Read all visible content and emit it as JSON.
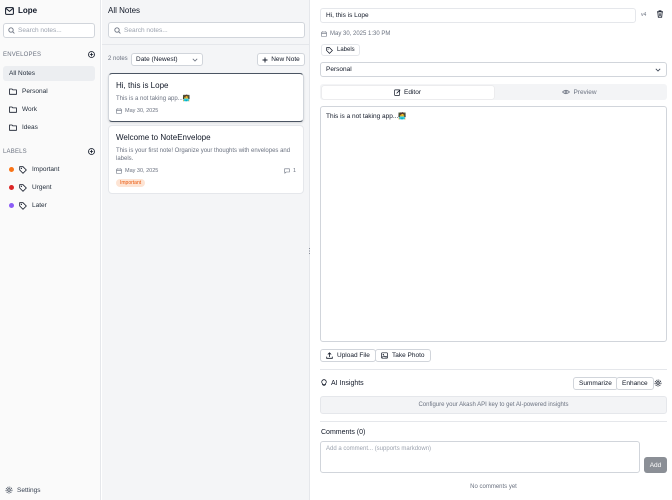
{
  "app": {
    "name": "Lope"
  },
  "sidebar": {
    "search_placeholder": "Search notes...",
    "envelopes_heading": "ENVELOPES",
    "envelopes": [
      {
        "label": "All Notes"
      },
      {
        "label": "Personal"
      },
      {
        "label": "Work"
      },
      {
        "label": "Ideas"
      }
    ],
    "labels_heading": "LABELS",
    "labels": [
      {
        "label": "Important",
        "color": "#f97316"
      },
      {
        "label": "Urgent",
        "color": "#dc2626"
      },
      {
        "label": "Later",
        "color": "#8b5cf6"
      }
    ],
    "settings_label": "Settings"
  },
  "notes": {
    "title": "All Notes",
    "search_placeholder": "Search notes...",
    "count_label": "2 notes",
    "sort_value": "Date (Newest)",
    "new_note_label": "New Note",
    "items": [
      {
        "title": "Hi, this is Lope",
        "preview": "This is a not taking app...🧑‍💻",
        "date": "May 30, 2025"
      },
      {
        "title": "Welcome to NoteEnvelope",
        "preview": "This is your first note! Organize your thoughts with envelopes and labels.",
        "date": "May 30, 2025",
        "comment_count": "1",
        "badge": "Important"
      }
    ]
  },
  "editor": {
    "title_value": "Hi, this is Lope",
    "version": "v4",
    "datetime": "May 30, 2025 1:30 PM",
    "labels_button": "Labels",
    "envelope_value": "Personal",
    "tab_editor": "Editor",
    "tab_preview": "Preview",
    "body": "This is a not taking app...🧑‍💻",
    "upload_label": "Upload File",
    "photo_label": "Take Photo",
    "ai_title": "AI Insights",
    "summarize_label": "Summarize",
    "enhance_label": "Enhance",
    "ai_message": "Configure your Akash API key to get AI-powered insights",
    "comments_title": "Comments (0)",
    "comment_placeholder": "Add a comment... (supports markdown)",
    "add_label": "Add",
    "no_comments": "No comments yet"
  }
}
